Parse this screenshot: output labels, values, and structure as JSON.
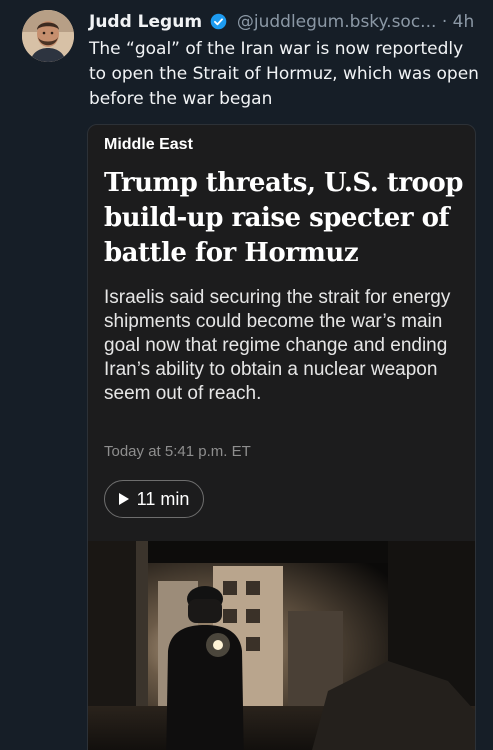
{
  "post": {
    "author_name": "Judd Legum",
    "handle": "@juddlegum.bsky.soc...",
    "separator": "·",
    "age": "4h",
    "text": "The “goal” of the Iran war is now reportedly to open the Strait of Hormuz, which was open before the war began",
    "avatar_icon": "avatar-photo",
    "verified_icon": "verified-badge-icon",
    "verified_color": "#1d9bf0"
  },
  "link_card": {
    "section": "Middle East",
    "headline": "Trump threats, U.S. troop build-up raise specter of battle for Hormuz",
    "summary": "Israelis said securing the strait for energy shipments could become the war’s main goal now that regime change and ending Iran’s ability to obtain a nuclear weapon seem out of reach.",
    "timestamp": "Today at 5:41 p.m. ET",
    "read_time": "11 min",
    "play_icon": "play-icon",
    "image_icon": "article-photo"
  }
}
